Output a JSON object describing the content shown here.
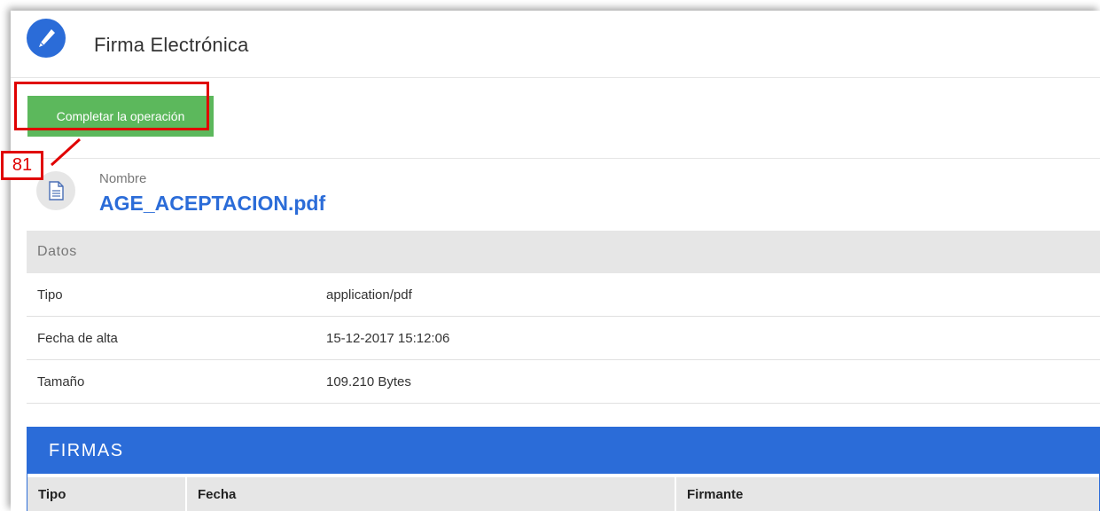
{
  "header": {
    "title": "Firma Electrónica",
    "logo_icon": "pen-icon",
    "accent": "#2b6cd8"
  },
  "actions": {
    "complete_label": "Completar la operación",
    "button_color": "#5cb85c"
  },
  "annotation": {
    "number": "81",
    "color": "#e00000"
  },
  "file": {
    "label": "Nombre",
    "name": "AGE_ACEPTACION.pdf",
    "icon": "document-icon"
  },
  "datos": {
    "title": "Datos",
    "rows": [
      {
        "key": "Tipo",
        "value": "application/pdf"
      },
      {
        "key": "Fecha de alta",
        "value": "15-12-2017 15:12:06"
      },
      {
        "key": "Tamaño",
        "value": "109.210 Bytes"
      }
    ]
  },
  "firmas": {
    "title": "FIRMAS",
    "columns": [
      "Tipo",
      "Fecha",
      "Firmante"
    ]
  }
}
